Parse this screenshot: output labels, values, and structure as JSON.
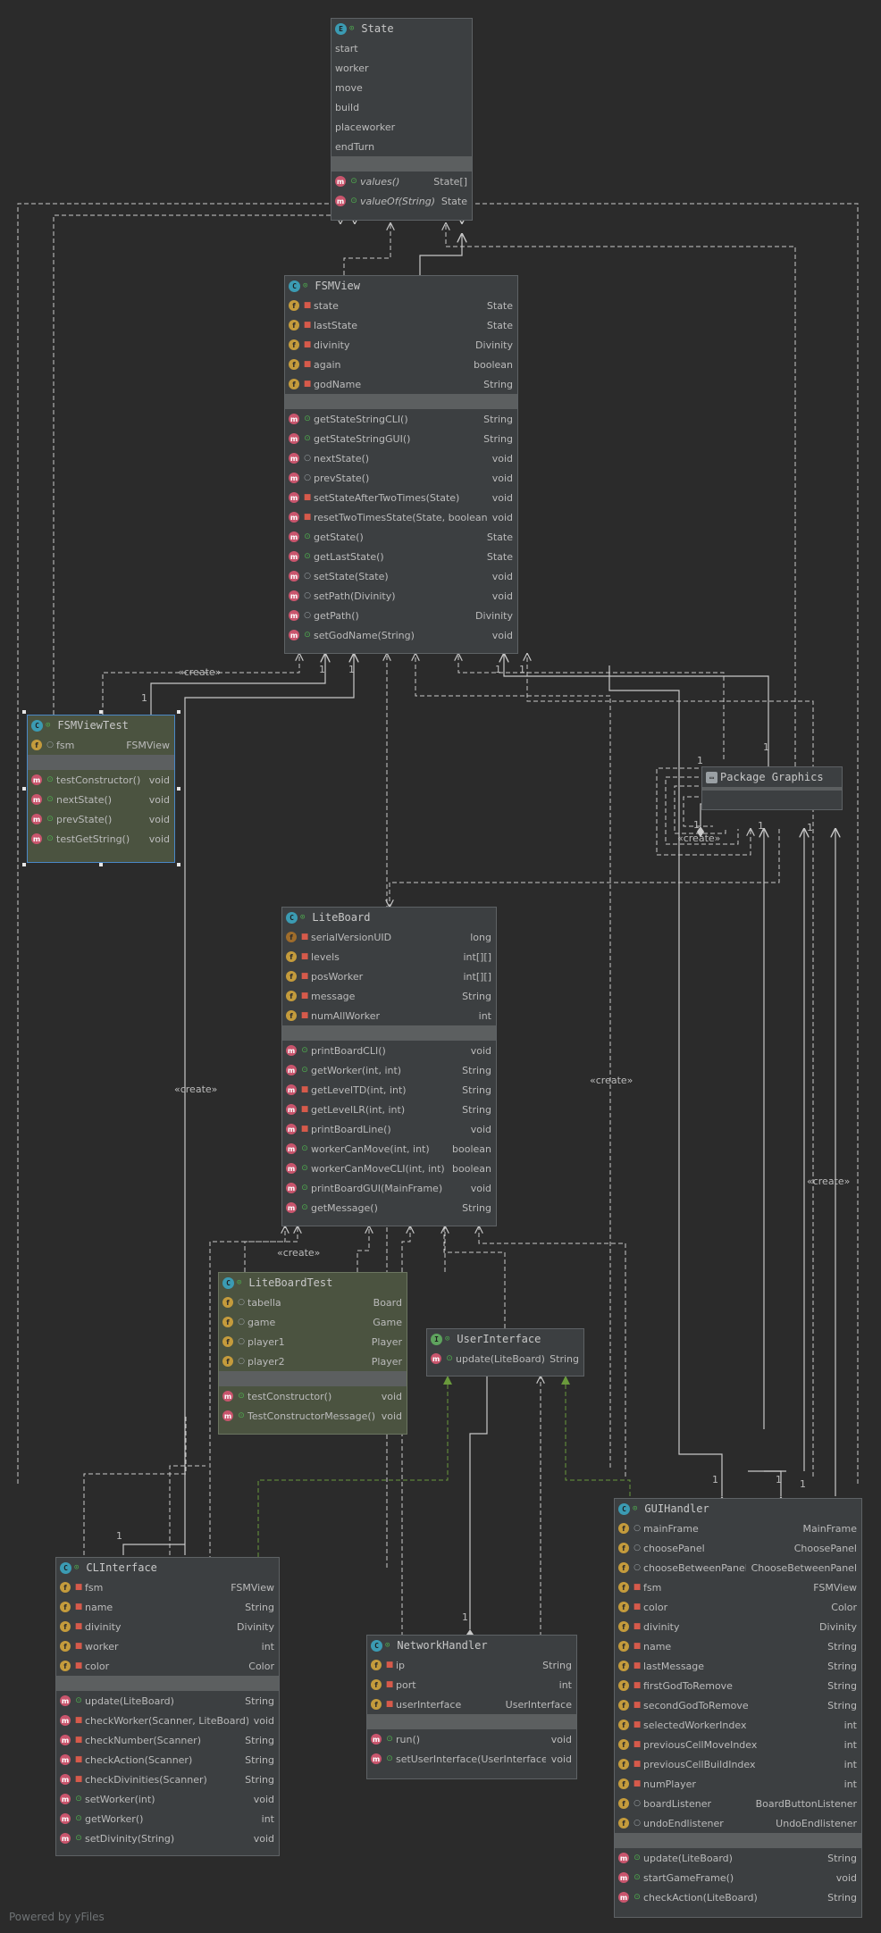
{
  "diagram": {
    "footer": "Powered by yFiles",
    "create_label": "«create»",
    "classes": {
      "State": {
        "kind_icon": "enum-icon",
        "name": "State",
        "fields": [
          {
            "vis": "pkg",
            "name": "start",
            "type": "",
            "icon": ""
          },
          {
            "vis": "pkg",
            "name": "worker",
            "type": "",
            "icon": ""
          },
          {
            "vis": "pkg",
            "name": "move",
            "type": "",
            "icon": ""
          },
          {
            "vis": "pkg",
            "name": "build",
            "type": "",
            "icon": ""
          },
          {
            "vis": "pkg",
            "name": "placeworker",
            "type": "",
            "icon": ""
          },
          {
            "vis": "pkg",
            "name": "endTurn",
            "type": "",
            "icon": ""
          }
        ],
        "methods": [
          {
            "vis": "pub",
            "name": "values()",
            "type": "State[]",
            "italic": true
          },
          {
            "vis": "pub",
            "name": "valueOf(String)",
            "type": "State",
            "italic": true
          }
        ]
      },
      "FSMView": {
        "name": "FSMView",
        "fields": [
          {
            "vis": "pri",
            "name": "state",
            "type": "State"
          },
          {
            "vis": "pri",
            "name": "lastState",
            "type": "State"
          },
          {
            "vis": "pri",
            "name": "divinity",
            "type": "Divinity"
          },
          {
            "vis": "pri",
            "name": "again",
            "type": "boolean"
          },
          {
            "vis": "pri",
            "name": "godName",
            "type": "String"
          }
        ],
        "methods": [
          {
            "vis": "pub",
            "name": "getStateStringCLI()",
            "type": "String"
          },
          {
            "vis": "pub",
            "name": "getStateStringGUI()",
            "type": "String"
          },
          {
            "vis": "pkg",
            "name": "nextState()",
            "type": "void"
          },
          {
            "vis": "pkg",
            "name": "prevState()",
            "type": "void"
          },
          {
            "vis": "pri",
            "name": "setStateAfterTwoTimes(State)",
            "type": "void"
          },
          {
            "vis": "pri",
            "name": "resetTwoTimesState(State, boolean)",
            "type": "void"
          },
          {
            "vis": "pub",
            "name": "getState()",
            "type": "State"
          },
          {
            "vis": "pub",
            "name": "getLastState()",
            "type": "State"
          },
          {
            "vis": "pkg",
            "name": "setState(State)",
            "type": "void"
          },
          {
            "vis": "pkg",
            "name": "setPath(Divinity)",
            "type": "void"
          },
          {
            "vis": "pkg",
            "name": "getPath()",
            "type": "Divinity"
          },
          {
            "vis": "pub",
            "name": "setGodName(String)",
            "type": "void"
          }
        ]
      },
      "FSMViewTest": {
        "name": "FSMViewTest",
        "fields": [
          {
            "vis": "pkg",
            "name": "fsm",
            "type": "FSMView"
          }
        ],
        "methods": [
          {
            "vis": "pub",
            "name": "testConstructor()",
            "type": "void"
          },
          {
            "vis": "pub",
            "name": "nextState()",
            "type": "void"
          },
          {
            "vis": "pub",
            "name": "prevState()",
            "type": "void"
          },
          {
            "vis": "pub",
            "name": "testGetString()",
            "type": "void"
          }
        ]
      },
      "PackageGraphics": {
        "name": "Package Graphics"
      },
      "LiteBoard": {
        "name": "LiteBoard",
        "fields": [
          {
            "vis": "pri",
            "name": "serialVersionUID",
            "type": "long",
            "static": true
          },
          {
            "vis": "pri",
            "name": "levels",
            "type": "int[][]"
          },
          {
            "vis": "pri",
            "name": "posWorker",
            "type": "int[][]"
          },
          {
            "vis": "pri",
            "name": "message",
            "type": "String"
          },
          {
            "vis": "pri",
            "name": "numAllWorker",
            "type": "int"
          }
        ],
        "methods": [
          {
            "vis": "pub",
            "name": "printBoardCLI()",
            "type": "void"
          },
          {
            "vis": "pub",
            "name": "getWorker(int, int)",
            "type": "String"
          },
          {
            "vis": "pri",
            "name": "getLevelTD(int, int)",
            "type": "String"
          },
          {
            "vis": "pri",
            "name": "getLevelLR(int, int)",
            "type": "String"
          },
          {
            "vis": "pri",
            "name": "printBoardLine()",
            "type": "void"
          },
          {
            "vis": "pub",
            "name": "workerCanMove(int, int)",
            "type": "boolean"
          },
          {
            "vis": "pub",
            "name": "workerCanMoveCLI(int, int)",
            "type": "boolean"
          },
          {
            "vis": "pub",
            "name": "printBoardGUI(MainFrame)",
            "type": "void"
          },
          {
            "vis": "pub",
            "name": "getMessage()",
            "type": "String"
          }
        ]
      },
      "LiteBoardTest": {
        "name": "LiteBoardTest",
        "fields": [
          {
            "vis": "pkg",
            "name": "tabella",
            "type": "Board"
          },
          {
            "vis": "pkg",
            "name": "game",
            "type": "Game"
          },
          {
            "vis": "pkg",
            "name": "player1",
            "type": "Player"
          },
          {
            "vis": "pkg",
            "name": "player2",
            "type": "Player"
          }
        ],
        "methods": [
          {
            "vis": "pub",
            "name": "testConstructor()",
            "type": "void"
          },
          {
            "vis": "pub",
            "name": "TestConstructorMessage()",
            "type": "void"
          }
        ]
      },
      "UserInterface": {
        "name": "UserInterface",
        "methods": [
          {
            "vis": "pub",
            "name": "update(LiteBoard)",
            "type": "String",
            "abstract": true
          }
        ]
      },
      "CLInterface": {
        "name": "CLInterface",
        "fields": [
          {
            "vis": "pri",
            "name": "fsm",
            "type": "FSMView"
          },
          {
            "vis": "pri",
            "name": "name",
            "type": "String"
          },
          {
            "vis": "pri",
            "name": "divinity",
            "type": "Divinity"
          },
          {
            "vis": "pri",
            "name": "worker",
            "type": "int"
          },
          {
            "vis": "pri",
            "name": "color",
            "type": "Color"
          }
        ],
        "methods": [
          {
            "vis": "pub",
            "name": "update(LiteBoard)",
            "type": "String"
          },
          {
            "vis": "pri",
            "name": "checkWorker(Scanner, LiteBoard)",
            "type": "void"
          },
          {
            "vis": "pri",
            "name": "checkNumber(Scanner)",
            "type": "String"
          },
          {
            "vis": "pri",
            "name": "checkAction(Scanner)",
            "type": "String"
          },
          {
            "vis": "pri",
            "name": "checkDivinities(Scanner)",
            "type": "String"
          },
          {
            "vis": "pub",
            "name": "setWorker(int)",
            "type": "void"
          },
          {
            "vis": "pub",
            "name": "getWorker()",
            "type": "int"
          },
          {
            "vis": "pub",
            "name": "setDivinity(String)",
            "type": "void"
          }
        ]
      },
      "NetworkHandler": {
        "name": "NetworkHandler",
        "fields": [
          {
            "vis": "pri",
            "name": "ip",
            "type": "String"
          },
          {
            "vis": "pri",
            "name": "port",
            "type": "int"
          },
          {
            "vis": "pri",
            "name": "userInterface",
            "type": "UserInterface"
          }
        ],
        "methods": [
          {
            "vis": "pub",
            "name": "run()",
            "type": "void"
          },
          {
            "vis": "pub",
            "name": "setUserInterface(UserInterface)",
            "type": "void"
          }
        ]
      },
      "GUIHandler": {
        "name": "GUIHandler",
        "fields": [
          {
            "vis": "pkg",
            "name": "mainFrame",
            "type": "MainFrame"
          },
          {
            "vis": "pkg",
            "name": "choosePanel",
            "type": "ChoosePanel"
          },
          {
            "vis": "pkg",
            "name": "chooseBetweenPanel",
            "type": "ChooseBetweenPanel"
          },
          {
            "vis": "pri",
            "name": "fsm",
            "type": "FSMView"
          },
          {
            "vis": "pri",
            "name": "color",
            "type": "Color"
          },
          {
            "vis": "pri",
            "name": "divinity",
            "type": "Divinity"
          },
          {
            "vis": "pri",
            "name": "name",
            "type": "String"
          },
          {
            "vis": "pri",
            "name": "lastMessage",
            "type": "String"
          },
          {
            "vis": "pri",
            "name": "firstGodToRemove",
            "type": "String"
          },
          {
            "vis": "pri",
            "name": "secondGodToRemove",
            "type": "String"
          },
          {
            "vis": "pri",
            "name": "selectedWorkerIndex",
            "type": "int"
          },
          {
            "vis": "pri",
            "name": "previousCellMoveIndex",
            "type": "int"
          },
          {
            "vis": "pri",
            "name": "previousCellBuildIndex",
            "type": "int"
          },
          {
            "vis": "pri",
            "name": "numPlayer",
            "type": "int"
          },
          {
            "vis": "pkg",
            "name": "boardListener",
            "type": "BoardButtonListener"
          },
          {
            "vis": "pkg",
            "name": "undoEndlistener",
            "type": "UndoEndlistener"
          }
        ],
        "methods": [
          {
            "vis": "pub",
            "name": "update(LiteBoard)",
            "type": "String"
          },
          {
            "vis": "pub",
            "name": "startGameFrame()",
            "type": "void"
          },
          {
            "vis": "pub",
            "name": "checkAction(LiteBoard)",
            "type": "String"
          }
        ]
      }
    },
    "multiplicities": [
      "1",
      "1",
      "1",
      "1",
      "1",
      "1",
      "1",
      "1",
      "1",
      "1",
      "1",
      "1",
      "1",
      "1",
      "1",
      "1",
      "1",
      "1"
    ],
    "colors": {
      "background": "#2b2b2b",
      "node": "#3c3f41",
      "test_node": "#4b5340",
      "edge": "#c8c8c8",
      "realization": "#6a9a3c",
      "selection": "#4a88c7"
    }
  }
}
